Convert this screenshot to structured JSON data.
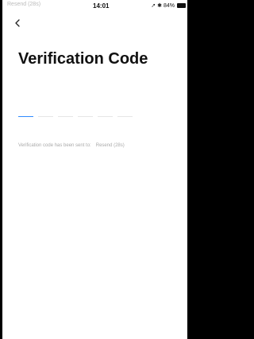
{
  "status_bar": {
    "ghost_text": "Resend (28s)",
    "time": "14:01",
    "indicators": "➚ ✱ 84%",
    "battery_icon": "battery-icon"
  },
  "header": {
    "back_icon": "chevron-left-icon",
    "title": "Verification Code"
  },
  "code_input": {
    "slot_count": 6,
    "active_slot": 1,
    "active_color": "#2f8bff"
  },
  "info": {
    "sent_text": "Verification code has been sent to:",
    "resend_label": "Resend (28s)"
  }
}
